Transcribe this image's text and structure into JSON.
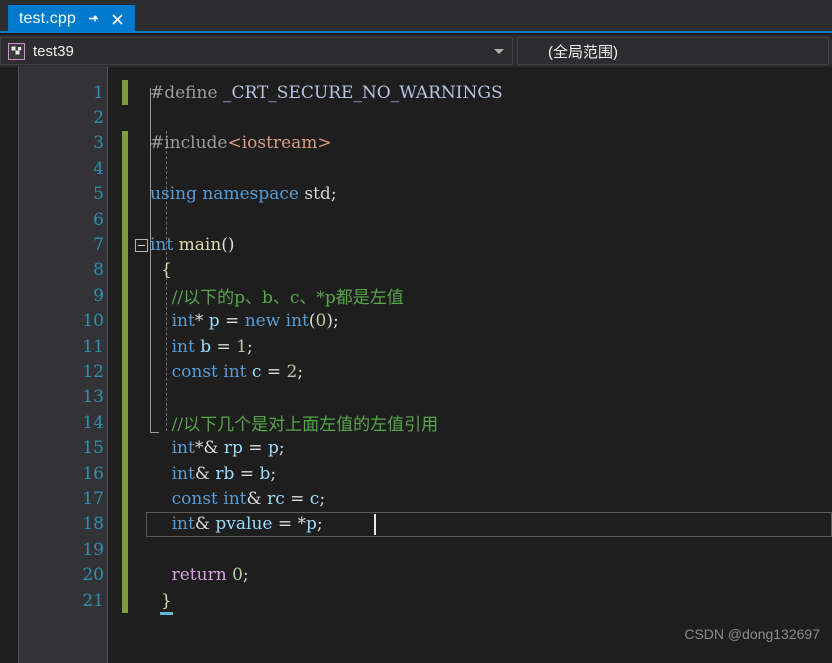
{
  "tab": {
    "filename": "test.cpp",
    "pin_icon": "pin-icon",
    "close_icon": "close-icon",
    "active_color": "#007acc"
  },
  "navbar": {
    "project": {
      "label": "test39",
      "icon": "cpp-project-icon",
      "caret_icon": "chevron-down-icon"
    },
    "scope": {
      "label": "(全局范围)"
    }
  },
  "editor": {
    "language": "cpp",
    "current_line": 18,
    "lines": [
      {
        "n": "1",
        "changed": true,
        "text": "#define _CRT_SECURE_NO_WARNINGS"
      },
      {
        "n": "2",
        "changed": false,
        "text": ""
      },
      {
        "n": "3",
        "changed": true,
        "text": "#include<iostream>"
      },
      {
        "n": "4",
        "changed": true,
        "text": ""
      },
      {
        "n": "5",
        "changed": true,
        "text": "using namespace std;"
      },
      {
        "n": "6",
        "changed": true,
        "text": ""
      },
      {
        "n": "7",
        "changed": true,
        "text": "int main()"
      },
      {
        "n": "8",
        "changed": true,
        "text": "{"
      },
      {
        "n": "9",
        "changed": true,
        "text": "    //以下的p、b、c、*p都是左值"
      },
      {
        "n": "10",
        "changed": true,
        "text": "    int* p = new int(0);"
      },
      {
        "n": "11",
        "changed": true,
        "text": "    int b = 1;"
      },
      {
        "n": "12",
        "changed": true,
        "text": "    const int c = 2;"
      },
      {
        "n": "13",
        "changed": true,
        "text": ""
      },
      {
        "n": "14",
        "changed": true,
        "text": "    //以下几个是对上面左值的左值引用"
      },
      {
        "n": "15",
        "changed": true,
        "text": "    int*& rp = p;"
      },
      {
        "n": "16",
        "changed": true,
        "text": "    int& rb = b;"
      },
      {
        "n": "17",
        "changed": true,
        "text": "    const int& rc = c;"
      },
      {
        "n": "18",
        "changed": true,
        "text": "    int& pvalue = *p;"
      },
      {
        "n": "19",
        "changed": true,
        "text": ""
      },
      {
        "n": "20",
        "changed": true,
        "text": "    return 0;"
      },
      {
        "n": "21",
        "changed": true,
        "text": "}"
      }
    ]
  },
  "watermark": {
    "text": "CSDN @dong132697"
  },
  "colors": {
    "accent": "#007acc",
    "editor_background": "#1e1e1e",
    "chrome_background": "#2d2d30",
    "gutter_background": "#333337",
    "line_number": "#2b91af",
    "comment": "#57a64a",
    "keyword": "#569cd6",
    "identifier": "#9cdcfe",
    "number": "#b5cea8",
    "include_string": "#d69d85",
    "change_bar": "#7e9d3a"
  }
}
